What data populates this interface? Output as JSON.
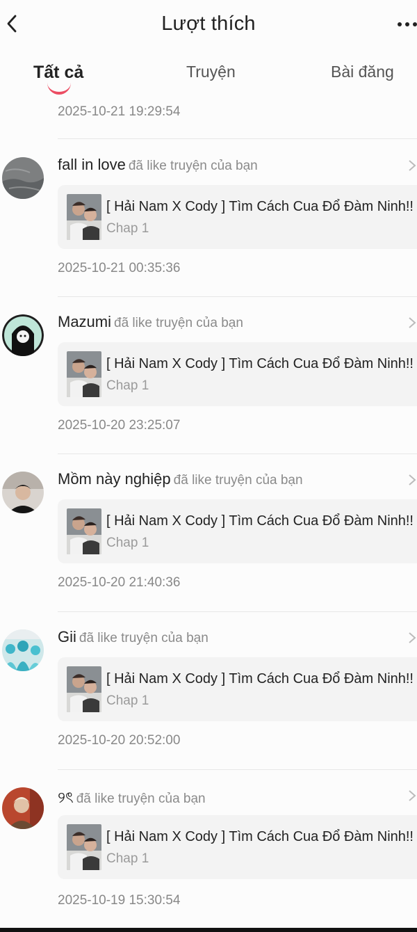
{
  "header": {
    "title": "Lượt thích"
  },
  "tabs": [
    {
      "label": "Tất cả",
      "active": true
    },
    {
      "label": "Truyện",
      "active": false
    },
    {
      "label": "Bài đăng",
      "active": false
    }
  ],
  "top_timestamp": "2025-10-21 19:29:54",
  "action_text": "đã like truyện của bạn",
  "items": [
    {
      "username": "fall in love",
      "action": "đã like truyện của bạn",
      "story_title": "[ Hải Nam X Cody ] Tìm Cách Cua Đổ Đàm Ninh!!",
      "chapter": "Chap 1",
      "timestamp": "2025-10-21 00:35:36"
    },
    {
      "username": "Mazumi",
      "action": "đã like truyện của bạn",
      "story_title": "[ Hải Nam X Cody ] Tìm Cách Cua Đổ Đàm Ninh!!",
      "chapter": "Chap 1",
      "timestamp": "2025-10-20 23:25:07"
    },
    {
      "username": "Mồm này nghiệp",
      "action": "đã like truyện của bạn",
      "story_title": "[ Hải Nam X Cody ] Tìm Cách Cua Đổ Đàm Ninh!!",
      "chapter": "Chap 1",
      "timestamp": "2025-10-20 21:40:36"
    },
    {
      "username": "Gii",
      "action": "đã like truyện của bạn",
      "story_title": "[ Hải Nam X Cody ] Tìm Cách Cua Đổ Đàm Ninh!!",
      "chapter": "Chap 1",
      "timestamp": "2025-10-20 20:52:00"
    },
    {
      "username": "୨ৎ",
      "action": "đã like truyện của bạn",
      "story_title": "[ Hải Nam X Cody ] Tìm Cách Cua Đổ Đàm Ninh!!",
      "chapter": "Chap 1",
      "timestamp": "2025-10-19 15:30:54"
    }
  ],
  "icons": {
    "back": "chevron-left-icon",
    "more": "more-dots-icon",
    "row_arrow": "chevron-right-icon"
  },
  "colors": {
    "accent": "#ec4d63",
    "muted_text": "#888888",
    "card_bg": "#f3f3f3"
  }
}
